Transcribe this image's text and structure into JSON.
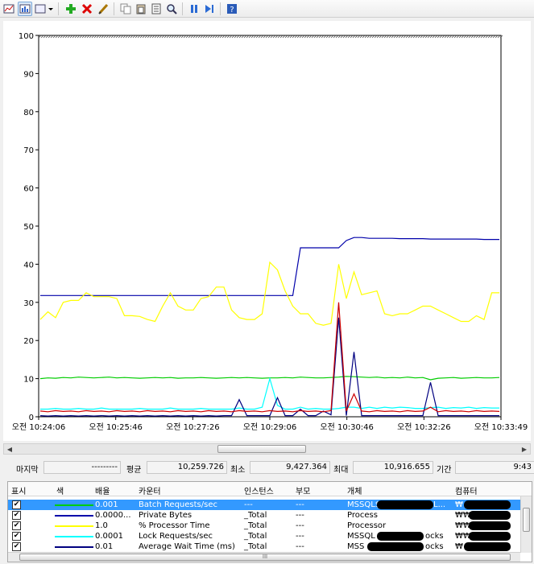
{
  "toolbar": {
    "buttons": [
      {
        "name": "view-graph-icon"
      },
      {
        "name": "view-histogram-icon"
      },
      {
        "name": "change-view-dropdown-icon"
      },
      {
        "name": "add-counter-icon"
      },
      {
        "name": "delete-counter-icon"
      },
      {
        "name": "highlight-icon"
      },
      {
        "name": "copy-properties-icon"
      },
      {
        "name": "paste-counter-list-icon"
      },
      {
        "name": "properties-icon"
      },
      {
        "name": "zoom-icon"
      },
      {
        "name": "freeze-display-icon"
      },
      {
        "name": "update-data-icon"
      },
      {
        "name": "help-icon"
      }
    ]
  },
  "chart_data": {
    "type": "line",
    "ylim": [
      0,
      100
    ],
    "yticks": [
      "0",
      "10",
      "20",
      "30",
      "40",
      "50",
      "60",
      "70",
      "80",
      "90",
      "100"
    ],
    "xticks": [
      "오전 10:24:06",
      "오전 10:25:46",
      "오전 10:27:26",
      "오전 10:29:06",
      "오전 10:30:46",
      "오전 10:32:26",
      "오전 10:33:49"
    ],
    "grid": false,
    "series": [
      {
        "name": "Batch Requests/sec",
        "color": "#00cc00",
        "values": [
          10,
          10.2,
          10.1,
          10.3,
          10.2,
          10.4,
          10.3,
          10.2,
          10.3,
          10.4,
          10.2,
          10.3,
          10.2,
          10.1,
          10.2,
          10.3,
          10.2,
          10.3,
          10.1,
          10.2,
          10.2,
          10.3,
          10.2,
          10.1,
          10.2,
          10.3,
          10.2,
          10.3,
          10.2,
          10.1,
          10.2,
          10.2,
          10.3,
          10.2,
          10.4,
          10.3,
          10.2,
          10.2,
          10.3,
          10.4,
          10.6,
          10.5,
          10.4,
          10.3,
          10.4,
          10.2,
          10.3,
          10.2,
          10.4,
          10.2,
          10.3,
          9.7,
          10.1,
          10.2,
          10.3,
          10.1,
          10.2,
          10.3,
          10.2,
          10.2,
          10.3
        ]
      },
      {
        "name": "Private Bytes",
        "color": "#0000aa",
        "values": [
          31.8,
          31.8,
          31.8,
          31.8,
          31.8,
          31.8,
          31.8,
          31.8,
          31.8,
          31.8,
          31.8,
          31.8,
          31.8,
          31.8,
          31.8,
          31.8,
          31.8,
          31.8,
          31.8,
          31.8,
          31.8,
          31.8,
          31.8,
          31.8,
          31.8,
          31.8,
          31.8,
          31.8,
          31.8,
          31.8,
          31.8,
          31.8,
          31.8,
          31.8,
          44.3,
          44.3,
          44.3,
          44.3,
          44.3,
          44.3,
          46.2,
          47,
          47,
          46.8,
          46.8,
          46.8,
          46.8,
          46.7,
          46.7,
          46.7,
          46.7,
          46.6,
          46.6,
          46.6,
          46.6,
          46.6,
          46.6,
          46.6,
          46.5,
          46.5,
          46.5
        ]
      },
      {
        "name": "% Processor Time",
        "color": "#ffff00",
        "values": [
          25.5,
          27.5,
          26,
          30,
          30.5,
          30.5,
          32.5,
          31.5,
          31.5,
          31.5,
          31,
          26.5,
          26.5,
          26.3,
          25.5,
          25,
          29,
          32.5,
          29,
          28,
          28,
          31,
          31.5,
          34,
          34,
          28,
          26,
          25.5,
          25.5,
          27,
          40.5,
          38.5,
          33,
          29,
          27,
          27,
          24.5,
          24,
          24.5,
          40,
          31,
          38,
          32,
          32.5,
          33,
          27,
          26.5,
          27,
          27,
          28,
          29,
          29,
          28,
          27,
          26,
          25,
          25,
          26.5,
          25.5,
          32.5,
          32.5
        ]
      },
      {
        "name": "Lock Requests/sec",
        "color": "#00ffff",
        "values": [
          2,
          2,
          2.2,
          2,
          2,
          2.2,
          2,
          2,
          2.3,
          2,
          2,
          2,
          2,
          2.2,
          2,
          2,
          2,
          2.3,
          2,
          2,
          2,
          2.2,
          2,
          2,
          2,
          2,
          2.3,
          2,
          2,
          2.5,
          10,
          3,
          2,
          2,
          2.5,
          2,
          2.2,
          2,
          2,
          2.2,
          2.5,
          2.5,
          2.2,
          2.5,
          2.2,
          2.5,
          2.3,
          2.5,
          2.4,
          2.2,
          2.2,
          2.4,
          2.5,
          2.2,
          2.4,
          2.3,
          2.5,
          2.2,
          2.4,
          2.3,
          2.3
        ]
      },
      {
        "name": "Average Wait Time (ms)",
        "color": "#000080",
        "values": [
          0.3,
          0.2,
          0.3,
          0.2,
          0.3,
          0.2,
          0.3,
          0.2,
          0.3,
          0.2,
          0.3,
          0.2,
          0.3,
          0.2,
          0.3,
          0.2,
          0.3,
          0.2,
          0.3,
          0.2,
          0.3,
          0.2,
          0.3,
          0.2,
          0.3,
          0.3,
          4.5,
          0.3,
          0.3,
          0.3,
          0.3,
          5,
          0.3,
          0.3,
          2,
          0.3,
          0.3,
          1.5,
          0.5,
          26,
          0.3,
          17,
          0.3,
          0.3,
          0.3,
          0.3,
          0.3,
          0.3,
          0.3,
          0.3,
          0.3,
          9,
          0.3,
          0.3,
          0.3,
          0.3,
          0.3,
          0.3,
          0.3,
          0.3,
          0.3
        ]
      },
      {
        "color": "#cc0000",
        "values": [
          1.5,
          1.3,
          1.6,
          1.4,
          1.5,
          1.3,
          1.6,
          1.4,
          1.5,
          1.3,
          1.6,
          1.4,
          1.5,
          1.3,
          1.6,
          1.4,
          1.5,
          1.3,
          1.6,
          1.4,
          1.5,
          1.3,
          1.6,
          1.4,
          1.5,
          1.3,
          1.6,
          1.4,
          1.5,
          1.3,
          1.6,
          1.4,
          1.5,
          1.3,
          1.6,
          1.4,
          1.5,
          1.3,
          1.6,
          30,
          1.5,
          6,
          1.5,
          1.3,
          1.6,
          1.4,
          1.5,
          1.3,
          1.6,
          1.4,
          1.5,
          2.5,
          1.3,
          1.6,
          1.4,
          1.5,
          1.3,
          1.6,
          1.4,
          1.5,
          1.4
        ]
      }
    ]
  },
  "stats": {
    "last_label": "마지막",
    "last_value": "---------",
    "avg_label": "평균",
    "avg_value": "10,259.726",
    "min_label": "최소",
    "min_value": "9,427.364",
    "max_label": "최대",
    "max_value": "10,916.655",
    "dur_label": "기간",
    "dur_value": "9:43"
  },
  "list": {
    "headers": [
      "표시",
      "색",
      "배율",
      "카운터",
      "인스턴스",
      "부모",
      "개체",
      "컴퓨터"
    ],
    "rows": [
      {
        "show": "✔",
        "color": "#00cc00",
        "scale": "0.001",
        "counter": "Batch Requests/sec",
        "instance": "---",
        "parent": "---",
        "object": "MSSQL$",
        "object_suffix": "L...",
        "computer": "₩",
        "selected": true
      },
      {
        "show": "✔",
        "color": "#0000aa",
        "scale": "0.0000...",
        "counter": "Private Bytes",
        "instance": "_Total",
        "parent": "---",
        "object": "Process",
        "object_suffix": "",
        "computer": "₩₩",
        "selected": false
      },
      {
        "show": "✔",
        "color": "#ffff00",
        "scale": "1.0",
        "counter": "% Processor Time",
        "instance": "_Total",
        "parent": "---",
        "object": "Processor",
        "object_suffix": "",
        "computer": "₩₩",
        "selected": false
      },
      {
        "show": "✔",
        "color": "#00ffff",
        "scale": "0.0001",
        "counter": "Lock Requests/sec",
        "instance": "_Total",
        "parent": "---",
        "object": "MSSQL",
        "object_suffix": "ocks",
        "computer": "₩₩",
        "selected": false
      },
      {
        "show": "✔",
        "color": "#000080",
        "scale": "0.01",
        "counter": "Average Wait Time (ms)",
        "instance": "_Total",
        "parent": "---",
        "object": "MSS",
        "object_suffix": "ocks",
        "computer": "₩",
        "selected": false
      }
    ]
  }
}
